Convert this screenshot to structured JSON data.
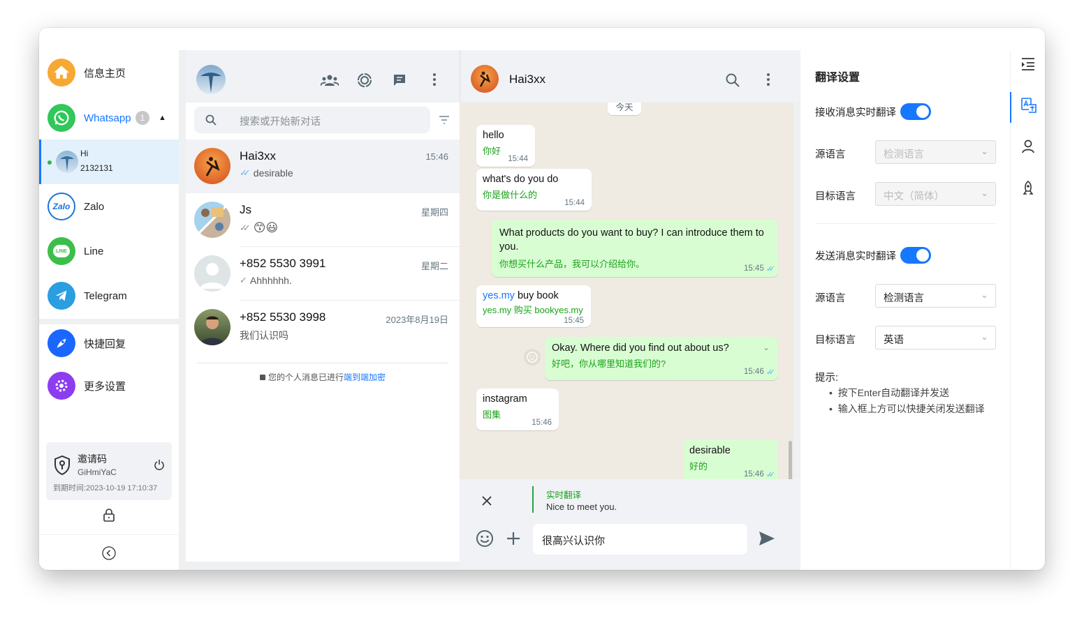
{
  "sidebar": {
    "home_label": "信息主页",
    "whatsapp_label": "Whatsapp",
    "whatsapp_badge": "1",
    "account_name": "Hi",
    "account_number": "2132131",
    "zalo_label": "Zalo",
    "zalo_logo": "Zalo",
    "line_label": "Line",
    "line_logo": "LINE",
    "telegram_label": "Telegram",
    "quick_reply_label": "快捷回复",
    "settings_label": "更多设置",
    "invite_title": "邀请码",
    "invite_code": "GiHmiYaC",
    "invite_expiry": "到期时间:2023-10-19 17:10:37"
  },
  "chat_list": {
    "search_placeholder": "搜索或开始新对话",
    "chats": [
      {
        "name": "Hai3xx",
        "time": "15:46",
        "preview": "desirable"
      },
      {
        "name": "Js",
        "time": "星期四",
        "preview": "😙😃"
      },
      {
        "name": "+852 5530 3991",
        "time": "星期二",
        "preview": "Ahhhhhh."
      },
      {
        "name": "+852 5530 3998",
        "time": "2023年8月19日",
        "preview": "我们认识吗"
      }
    ],
    "encryption_text": "您的个人消息已进行",
    "encryption_link": "端到端加密"
  },
  "conversation": {
    "contact_name": "Hai3xx",
    "date_chip": "今天",
    "messages": [
      {
        "dir": "in",
        "text": "hello",
        "translation": "你好",
        "time": "15:44"
      },
      {
        "dir": "in",
        "text": "what's do you do",
        "translation": "你是做什么的",
        "time": "15:44"
      },
      {
        "dir": "out",
        "text": "What products do you want to buy? I can introduce them to you.",
        "translation": "你想买什么产品，我可以介绍给你。",
        "time": "15:45"
      },
      {
        "dir": "in",
        "text_link": "yes.my",
        "text": " buy book",
        "translation": "yes.my 购买 bookyes.my",
        "time": "15:45"
      },
      {
        "dir": "out",
        "text": "Okay. Where did you find out about us?",
        "translation": "好吧，你从哪里知道我们的?",
        "time": "15:46"
      },
      {
        "dir": "in",
        "text": "instagram",
        "translation": "图集",
        "time": "15:46"
      },
      {
        "dir": "out",
        "text": "desirable",
        "translation": "好的",
        "time": "15:46"
      }
    ],
    "live_translation_label": "实时翻译",
    "live_translation_text": "Nice to meet you.",
    "input_value": "很高兴认识你"
  },
  "translation_settings": {
    "title": "翻译设置",
    "receive_label": "接收消息实时翻译",
    "receive_enabled": true,
    "receive_source_label": "源语言",
    "receive_source_value": "检测语言",
    "receive_target_label": "目标语言",
    "receive_target_value": "中文（简体）",
    "send_label": "发送消息实时翻译",
    "send_enabled": true,
    "send_source_label": "源语言",
    "send_source_value": "检测语言",
    "send_target_label": "目标语言",
    "send_target_value": "英语",
    "tips_title": "提示:",
    "tips": [
      "按下Enter自动翻译并发送",
      "输入框上方可以快捷关闭发送翻译"
    ]
  },
  "colors": {
    "accent": "#1677ff",
    "whatsapp_green": "#25d366",
    "outgoing_bubble": "#d9fdd3",
    "translation_green": "#1aa21a"
  }
}
